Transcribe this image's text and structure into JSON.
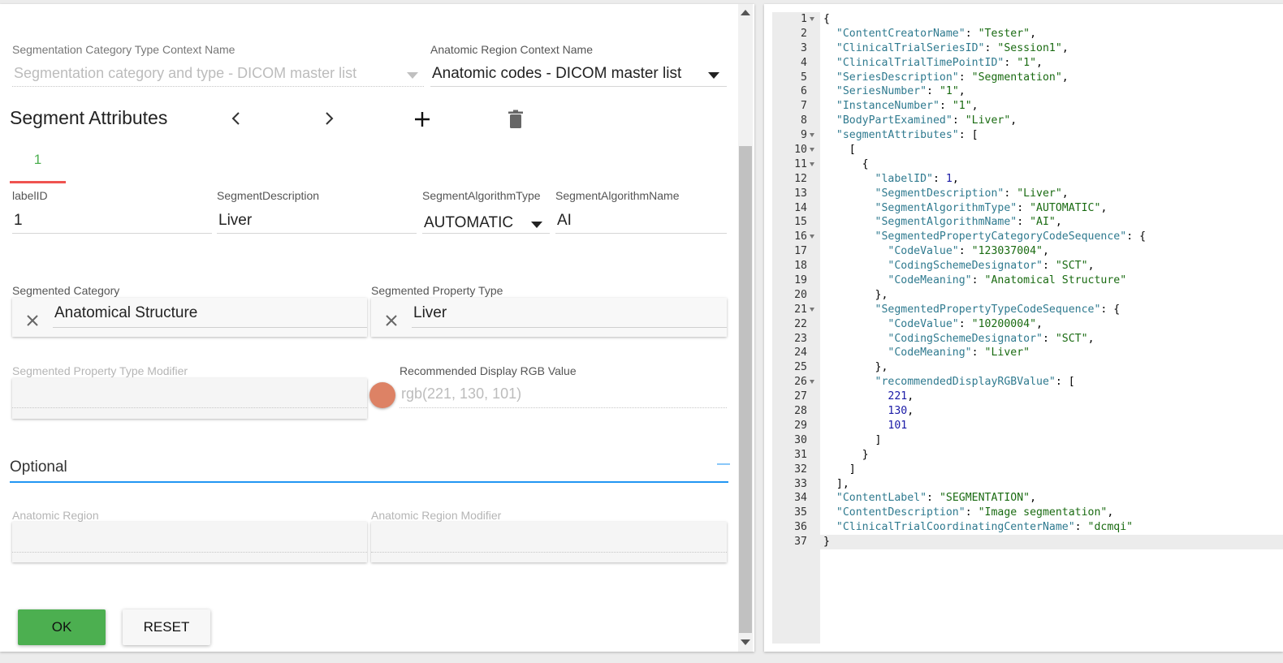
{
  "context": {
    "seg_category_label": "Segmentation Category Type Context Name",
    "seg_category_value": "Segmentation category and type - DICOM master list",
    "anatomic_region_label": "Anatomic Region Context Name",
    "anatomic_region_value": "Anatomic codes - DICOM master list"
  },
  "segment_attributes": {
    "title": "Segment Attributes",
    "active_tab": "1"
  },
  "fields": {
    "label_id_label": "labelID",
    "label_id_value": "1",
    "segment_description_label": "SegmentDescription",
    "segment_description_value": "Liver",
    "algorithm_type_label": "SegmentAlgorithmType",
    "algorithm_type_value": "AUTOMATIC",
    "algorithm_name_label": "SegmentAlgorithmName",
    "algorithm_name_value": "AI"
  },
  "segmented": {
    "category_label": "Segmented Category",
    "category_value": "Anatomical Structure",
    "property_type_label": "Segmented Property Type",
    "property_type_value": "Liver",
    "modifier_label": "Segmented Property Type Modifier",
    "rgb_label": "Recommended Display RGB Value",
    "rgb_value": "rgb(221, 130, 101)",
    "rgb_swatch_color": "#dd8265"
  },
  "optional": {
    "title": "Optional",
    "collapse_symbol": "—",
    "anatomic_region_label": "Anatomic Region",
    "anatomic_region_modifier_label": "Anatomic Region Modifier"
  },
  "buttons": {
    "ok": "OK",
    "reset": "RESET"
  },
  "colors": {
    "accent_green": "#4caf50",
    "tab_underline_red": "#ef5350",
    "optional_underline_blue": "#2196f3"
  },
  "code": {
    "lines": [
      {
        "n": "1",
        "fold": true,
        "t": "{"
      },
      {
        "n": "2",
        "t": "  \"ContentCreatorName\": \"Tester\","
      },
      {
        "n": "3",
        "t": "  \"ClinicalTrialSeriesID\": \"Session1\","
      },
      {
        "n": "4",
        "t": "  \"ClinicalTrialTimePointID\": \"1\","
      },
      {
        "n": "5",
        "t": "  \"SeriesDescription\": \"Segmentation\","
      },
      {
        "n": "6",
        "t": "  \"SeriesNumber\": \"1\","
      },
      {
        "n": "7",
        "t": "  \"InstanceNumber\": \"1\","
      },
      {
        "n": "8",
        "t": "  \"BodyPartExamined\": \"Liver\","
      },
      {
        "n": "9",
        "fold": true,
        "t": "  \"segmentAttributes\": ["
      },
      {
        "n": "10",
        "fold": true,
        "t": "    ["
      },
      {
        "n": "11",
        "fold": true,
        "t": "      {"
      },
      {
        "n": "12",
        "t": "        \"labelID\": 1,"
      },
      {
        "n": "13",
        "t": "        \"SegmentDescription\": \"Liver\","
      },
      {
        "n": "14",
        "t": "        \"SegmentAlgorithmType\": \"AUTOMATIC\","
      },
      {
        "n": "15",
        "t": "        \"SegmentAlgorithmName\": \"AI\","
      },
      {
        "n": "16",
        "fold": true,
        "t": "        \"SegmentedPropertyCategoryCodeSequence\": {"
      },
      {
        "n": "17",
        "t": "          \"CodeValue\": \"123037004\","
      },
      {
        "n": "18",
        "t": "          \"CodingSchemeDesignator\": \"SCT\","
      },
      {
        "n": "19",
        "t": "          \"CodeMeaning\": \"Anatomical Structure\""
      },
      {
        "n": "20",
        "t": "        },"
      },
      {
        "n": "21",
        "fold": true,
        "t": "        \"SegmentedPropertyTypeCodeSequence\": {"
      },
      {
        "n": "22",
        "t": "          \"CodeValue\": \"10200004\","
      },
      {
        "n": "23",
        "t": "          \"CodingSchemeDesignator\": \"SCT\","
      },
      {
        "n": "24",
        "t": "          \"CodeMeaning\": \"Liver\""
      },
      {
        "n": "25",
        "t": "        },"
      },
      {
        "n": "26",
        "fold": true,
        "t": "        \"recommendedDisplayRGBValue\": ["
      },
      {
        "n": "27",
        "t": "          221,"
      },
      {
        "n": "28",
        "t": "          130,"
      },
      {
        "n": "29",
        "t": "          101"
      },
      {
        "n": "30",
        "t": "        ]"
      },
      {
        "n": "31",
        "t": "      }"
      },
      {
        "n": "32",
        "t": "    ]"
      },
      {
        "n": "33",
        "t": "  ],"
      },
      {
        "n": "34",
        "t": "  \"ContentLabel\": \"SEGMENTATION\","
      },
      {
        "n": "35",
        "t": "  \"ContentDescription\": \"Image segmentation\","
      },
      {
        "n": "36",
        "t": "  \"ClinicalTrialCoordinatingCenterName\": \"dcmqi\""
      },
      {
        "n": "37",
        "active": true,
        "t": "}"
      }
    ]
  }
}
